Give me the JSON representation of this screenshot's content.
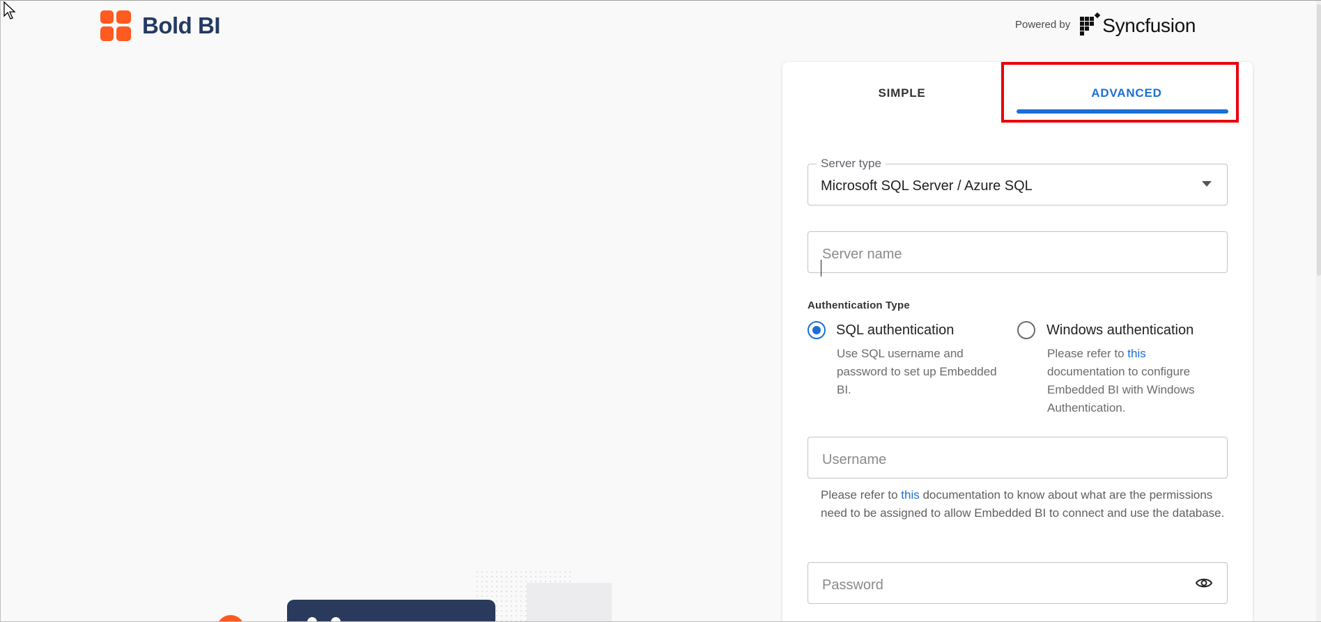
{
  "brand": {
    "name": "Bold BI",
    "accent": "#ff5a1f",
    "text_color": "#243a63"
  },
  "powered_by": {
    "label": "Powered by",
    "company": "Syncfusion"
  },
  "tabs": [
    {
      "label": "SIMPLE",
      "active": false
    },
    {
      "label": "ADVANCED",
      "active": true
    }
  ],
  "form": {
    "server_type": {
      "legend": "Server type",
      "value": "Microsoft SQL Server / Azure SQL"
    },
    "server_name": {
      "placeholder": "Server name"
    },
    "auth": {
      "label": "Authentication Type",
      "options": [
        {
          "label": "SQL authentication",
          "checked": true,
          "help": "Use SQL username and password to set up Embedded BI."
        },
        {
          "label": "Windows authentication",
          "checked": false,
          "help_prefix": "Please refer to ",
          "help_link": "this",
          "help_suffix": " documentation to configure Embedded BI with Windows Authentication."
        }
      ]
    },
    "username": {
      "placeholder": "Username"
    },
    "username_help": {
      "prefix": "Please refer to ",
      "link": "this",
      "suffix": " documentation to know about what are the permissions need to be assigned to allow Embedded BI to connect and use the database."
    },
    "password": {
      "placeholder": "Password"
    }
  },
  "colors": {
    "primary": "#1a6fd6",
    "highlight": "#e8000b"
  },
  "icons": [
    "mouse-cursor-icon",
    "bold-bi-logo-icon",
    "syncfusion-logo-icon",
    "dropdown-caret-icon",
    "eye-icon"
  ]
}
